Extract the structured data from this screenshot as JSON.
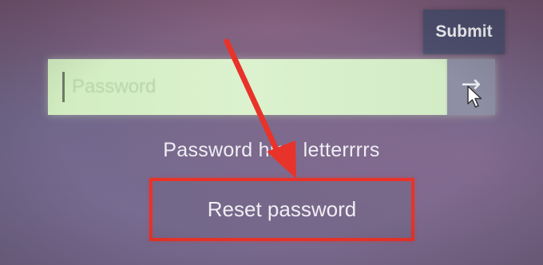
{
  "submit_button": {
    "label": "Submit"
  },
  "password_field": {
    "placeholder": "Password",
    "value": "",
    "submit_icon": "right-arrow-icon",
    "submit_glyph": "→"
  },
  "hint": {
    "text": "Password hint: letterrrrs"
  },
  "reset": {
    "label": "Reset password"
  },
  "annotation": {
    "highlight_color": "#e8332a"
  }
}
